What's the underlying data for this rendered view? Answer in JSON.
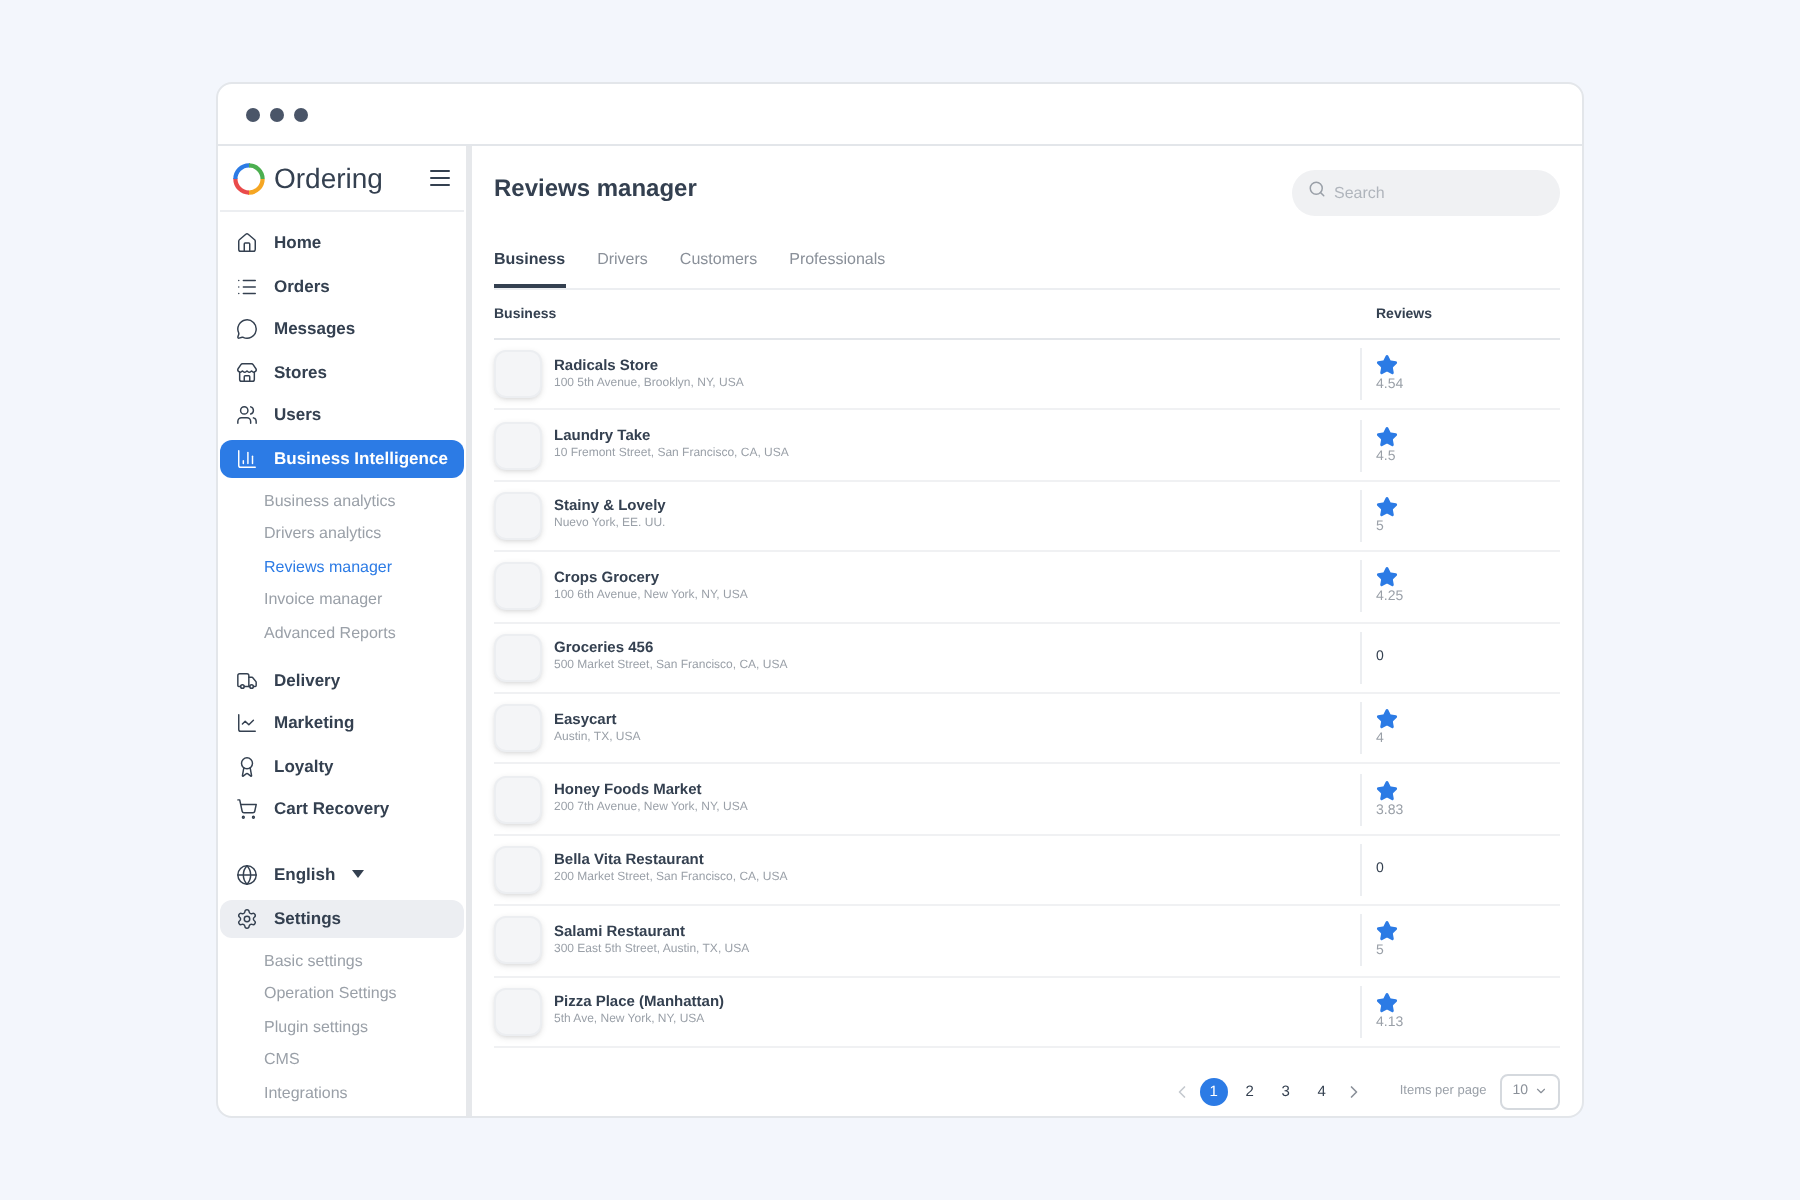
{
  "brand": {
    "name": "Ordering"
  },
  "sidebar": {
    "items": [
      {
        "label": "Home",
        "selected": false
      },
      {
        "label": "Orders",
        "selected": false
      },
      {
        "label": "Messages",
        "selected": false
      },
      {
        "label": "Stores",
        "selected": false
      },
      {
        "label": "Users",
        "selected": false
      },
      {
        "label": "Business Intelligence",
        "selected": true,
        "expanded": true,
        "children": [
          {
            "label": "Business analytics",
            "selected": false
          },
          {
            "label": "Drivers analytics",
            "selected": false
          },
          {
            "label": "Reviews manager",
            "selected": true
          },
          {
            "label": "Invoice manager",
            "selected": false
          },
          {
            "label": "Advanced Reports",
            "selected": false
          }
        ]
      },
      {
        "label": "Delivery",
        "selected": false
      },
      {
        "label": "Marketing",
        "selected": false
      },
      {
        "label": "Loyalty",
        "selected": false
      },
      {
        "label": "Cart Recovery",
        "selected": false
      }
    ],
    "language": "English",
    "settings": {
      "label": "Settings",
      "selected": false,
      "expanded": true,
      "children": [
        {
          "label": "Basic settings",
          "selected": false
        },
        {
          "label": "Operation Settings",
          "selected": false
        },
        {
          "label": "Plugin settings",
          "selected": false
        },
        {
          "label": "CMS",
          "selected": false
        },
        {
          "label": "Integrations",
          "selected": false
        }
      ]
    }
  },
  "page": {
    "title": "Reviews manager",
    "search": {
      "placeholder": "Search"
    }
  },
  "tabs": [
    {
      "label": "Business",
      "selected": true
    },
    {
      "label": "Drivers",
      "selected": false
    },
    {
      "label": "Customers",
      "selected": false
    },
    {
      "label": "Professionals",
      "selected": false
    }
  ],
  "table": {
    "columns": [
      "Business",
      "Reviews"
    ],
    "rows": [
      {
        "name": "Radicals Store",
        "address": "100 5th Avenue, Brooklyn, NY, USA",
        "rating": "4.54",
        "starred": true
      },
      {
        "name": "Laundry Take",
        "address": "10 Fremont Street, San Francisco, CA, USA",
        "rating": "4.5",
        "starred": true
      },
      {
        "name": "Stainy & Lovely",
        "address": "Nuevo York, EE. UU.",
        "rating": "5",
        "starred": true
      },
      {
        "name": "Crops Grocery",
        "address": "100 6th Avenue, New York, NY, USA",
        "rating": "4.25",
        "starred": true
      },
      {
        "name": "Groceries 456",
        "address": "500 Market Street, San Francisco, CA, USA",
        "rating": "0",
        "starred": false
      },
      {
        "name": "Easycart",
        "address": "Austin, TX, USA",
        "rating": "4",
        "starred": true
      },
      {
        "name": "Honey Foods Market",
        "address": "200 7th Avenue, New York, NY, USA",
        "rating": "3.83",
        "starred": true
      },
      {
        "name": "Bella Vita Restaurant",
        "address": "200 Market Street, San Francisco, CA, USA",
        "rating": "0",
        "starred": false
      },
      {
        "name": "Salami Restaurant",
        "address": "300 East 5th Street, Austin, TX, USA",
        "rating": "5",
        "starred": true
      },
      {
        "name": "Pizza Place (Manhattan)",
        "address": "5th Ave, New York, NY, USA",
        "rating": "4.13",
        "starred": true
      }
    ]
  },
  "pagination": {
    "pages": [
      {
        "label": "1",
        "selected": true
      },
      {
        "label": "2",
        "selected": false
      },
      {
        "label": "3",
        "selected": false
      },
      {
        "label": "4",
        "selected": false
      }
    ],
    "items_per_page_label": "Items per page",
    "items_per_page": "10"
  }
}
